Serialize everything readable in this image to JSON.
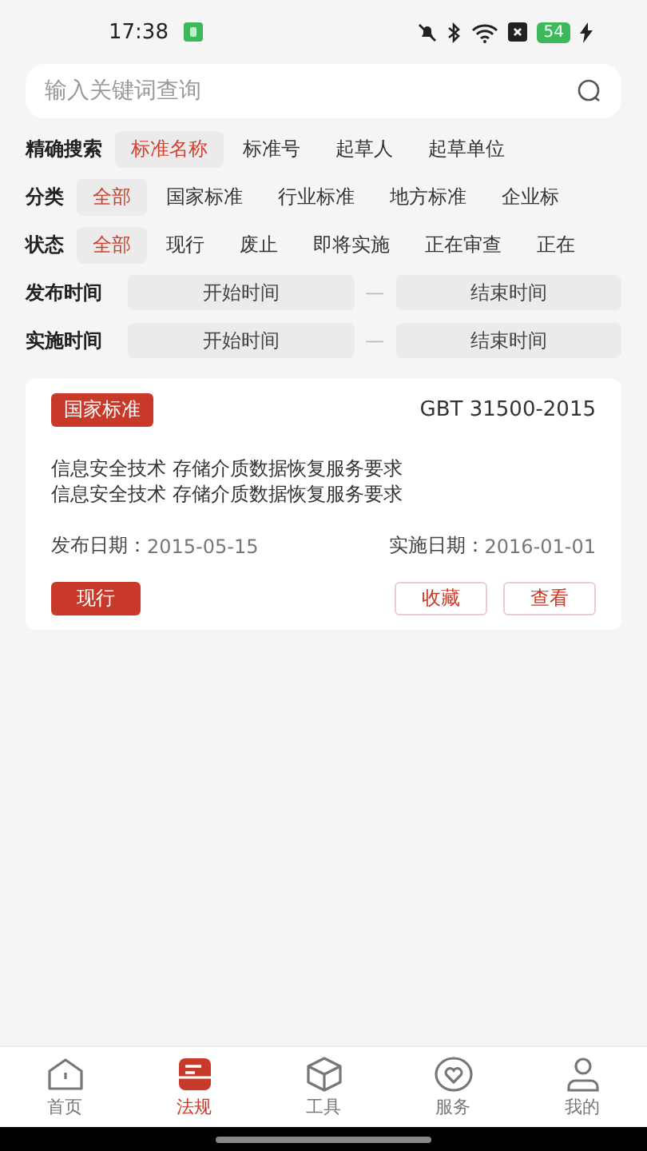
{
  "status_bar": {
    "time": "17:38",
    "battery": "54"
  },
  "search": {
    "placeholder": "输入关键词查询"
  },
  "filters": [
    {
      "label": "精确搜索",
      "options": [
        {
          "text": "标准名称",
          "selected": true
        },
        {
          "text": "标准号",
          "selected": false
        },
        {
          "text": "起草人",
          "selected": false
        },
        {
          "text": "起草单位",
          "selected": false
        }
      ]
    },
    {
      "label": "分类",
      "options": [
        {
          "text": "全部",
          "selected": true
        },
        {
          "text": "国家标准",
          "selected": false
        },
        {
          "text": "行业标准",
          "selected": false
        },
        {
          "text": "地方标准",
          "selected": false
        },
        {
          "text": "企业标",
          "selected": false
        }
      ]
    },
    {
      "label": "状态",
      "options": [
        {
          "text": "全部",
          "selected": true
        },
        {
          "text": "现行",
          "selected": false
        },
        {
          "text": "废止",
          "selected": false
        },
        {
          "text": "即将实施",
          "selected": false
        },
        {
          "text": "正在审查",
          "selected": false
        },
        {
          "text": "正在",
          "selected": false
        }
      ]
    }
  ],
  "date_filters": [
    {
      "label": "发布时间",
      "start_placeholder": "开始时间",
      "separator": "—",
      "end_placeholder": "结束时间"
    },
    {
      "label": "实施时间",
      "start_placeholder": "开始时间",
      "separator": "—",
      "end_placeholder": "结束时间"
    }
  ],
  "results": [
    {
      "category": "国家标准",
      "code": "GBT 31500-2015",
      "title_lines": [
        "信息安全技术 存储介质数据恢复服务要求",
        "信息安全技术 存储介质数据恢复服务要求"
      ],
      "publish_label": "发布日期：",
      "publish_date": "2015-05-15",
      "implement_label": "实施日期：",
      "implement_date": "2016-01-01",
      "status": "现行",
      "actions": [
        "收藏",
        "查看"
      ]
    }
  ],
  "tab_bar": [
    {
      "label": "首页",
      "selected": false
    },
    {
      "label": "法规",
      "selected": true
    },
    {
      "label": "工具",
      "selected": false
    },
    {
      "label": "服务",
      "selected": false
    },
    {
      "label": "我的",
      "selected": false
    }
  ]
}
